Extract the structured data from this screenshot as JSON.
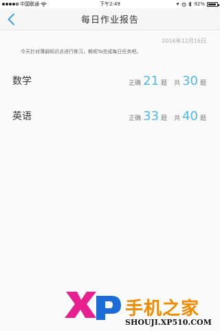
{
  "status_bar": {
    "carrier": "中国联通",
    "time": "下午2:49",
    "battery": "92%",
    "battery_level": 0.92
  },
  "nav": {
    "title": "每日作业报告",
    "back_icon": "chevron-left-icon"
  },
  "report": {
    "date": "2016年12月16日",
    "intro": "今天针对薄弱知识点进行练习，赖呢Ta完成每日任务吧。",
    "subjects": [
      {
        "name": "数学",
        "correct_label": "正确",
        "correct": "21",
        "unit": "题",
        "total_label": "共",
        "total": "30"
      },
      {
        "name": "英语",
        "correct_label": "正确",
        "correct": "33",
        "unit": "题",
        "total_label": "共",
        "total": "40"
      }
    ]
  },
  "watermark": {
    "logo_text": "XP",
    "site_name": "手机之家",
    "url": "SHOUJI.XP510.COM"
  }
}
